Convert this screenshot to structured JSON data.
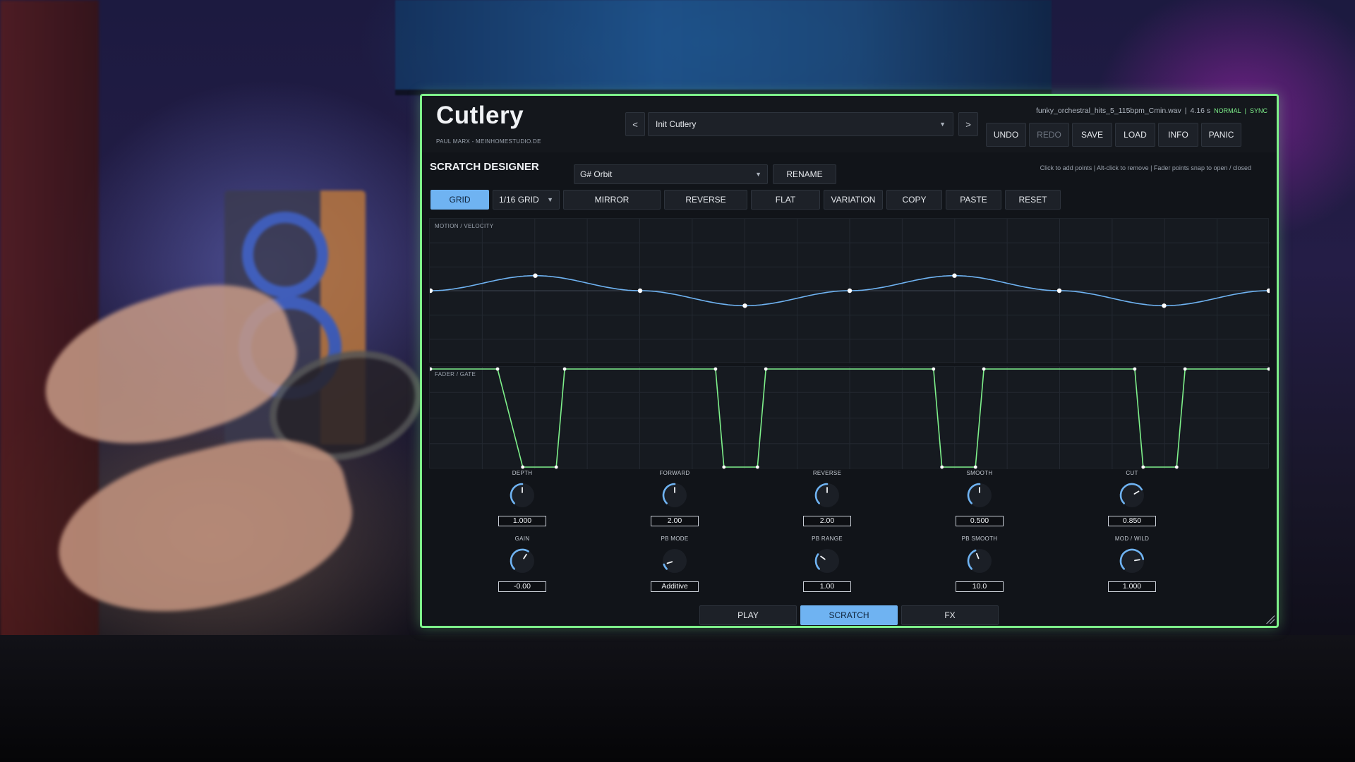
{
  "app": {
    "title": "Cutlery",
    "subtitle": "PAUL MARX  -  MEINHOMESTUDIO.DE",
    "accent_color": "#7ef08a",
    "active_color": "#6fb3f2"
  },
  "preset": {
    "prev_label": "<",
    "next_label": ">",
    "name": "Init Cutlery"
  },
  "file_info": {
    "filename": "funky_orchestral_hits_5_115bpm_Cmin.wav",
    "sep1": "|",
    "duration": "4.16 s",
    "mode": "NORMAL",
    "sep2": "|",
    "sync": "SYNC"
  },
  "header_buttons": {
    "undo": "UNDO",
    "redo": "REDO",
    "save": "SAVE",
    "load": "LOAD",
    "info": "INFO",
    "panic": "PANIC"
  },
  "scratch": {
    "section_title": "SCRATCH DESIGNER",
    "pattern_name": "G#  Orbit",
    "rename_label": "RENAME",
    "hint": "Click to add points  |  Alt-click to remove  |  Fader points snap to open / closed"
  },
  "toolbar": {
    "grid": "GRID",
    "grid_size": "1/16 GRID",
    "mirror": "MIRROR",
    "reverse": "REVERSE",
    "flat": "FLAT",
    "variation": "VARIATION",
    "copy": "COPY",
    "paste": "PASTE",
    "reset": "RESET"
  },
  "motion_panel": {
    "label": "MOTION / VELOCITY",
    "line_color": "#6fb3f2",
    "points": [
      [
        0,
        0
      ],
      [
        1,
        0.28
      ],
      [
        2,
        0
      ],
      [
        3,
        -0.28
      ],
      [
        4,
        0
      ],
      [
        5,
        0.28
      ],
      [
        6,
        0
      ],
      [
        7,
        -0.28
      ],
      [
        8,
        0
      ]
    ]
  },
  "fader_panel": {
    "label": "FADER / GATE",
    "line_color": "#7ef08a",
    "points": [
      [
        0,
        1
      ],
      [
        0.08,
        1
      ],
      [
        0.11,
        0
      ],
      [
        0.15,
        0
      ],
      [
        0.16,
        1
      ],
      [
        0.34,
        1
      ],
      [
        0.35,
        0
      ],
      [
        0.39,
        0
      ],
      [
        0.4,
        1
      ],
      [
        0.6,
        1
      ],
      [
        0.61,
        0
      ],
      [
        0.65,
        0
      ],
      [
        0.66,
        1
      ],
      [
        0.84,
        1
      ],
      [
        0.85,
        0
      ],
      [
        0.89,
        0
      ],
      [
        0.9,
        1
      ],
      [
        1,
        1
      ]
    ]
  },
  "knobs_row1": [
    {
      "label": "DEPTH",
      "value": "1.000",
      "level": 0.5
    },
    {
      "label": "FORWARD",
      "value": "2.00",
      "level": 0.5
    },
    {
      "label": "REVERSE",
      "value": "2.00",
      "level": 0.5
    },
    {
      "label": "SMOOTH",
      "value": "0.500",
      "level": 0.5
    },
    {
      "label": "CUT",
      "value": "0.850",
      "level": 0.72
    }
  ],
  "knobs_row2": [
    {
      "label": "GAIN",
      "value": "-0.00",
      "level": 0.62
    },
    {
      "label": "PB MODE",
      "value": "Additive",
      "level": 0.1
    },
    {
      "label": "PB RANGE",
      "value": "1.00",
      "level": 0.3
    },
    {
      "label": "PB SMOOTH",
      "value": "10.0",
      "level": 0.42
    },
    {
      "label": "MOD / WILD",
      "value": "1.000",
      "level": 0.8
    }
  ],
  "bottom_tabs": {
    "play": "PLAY",
    "scratch": "SCRATCH",
    "fx": "FX"
  }
}
